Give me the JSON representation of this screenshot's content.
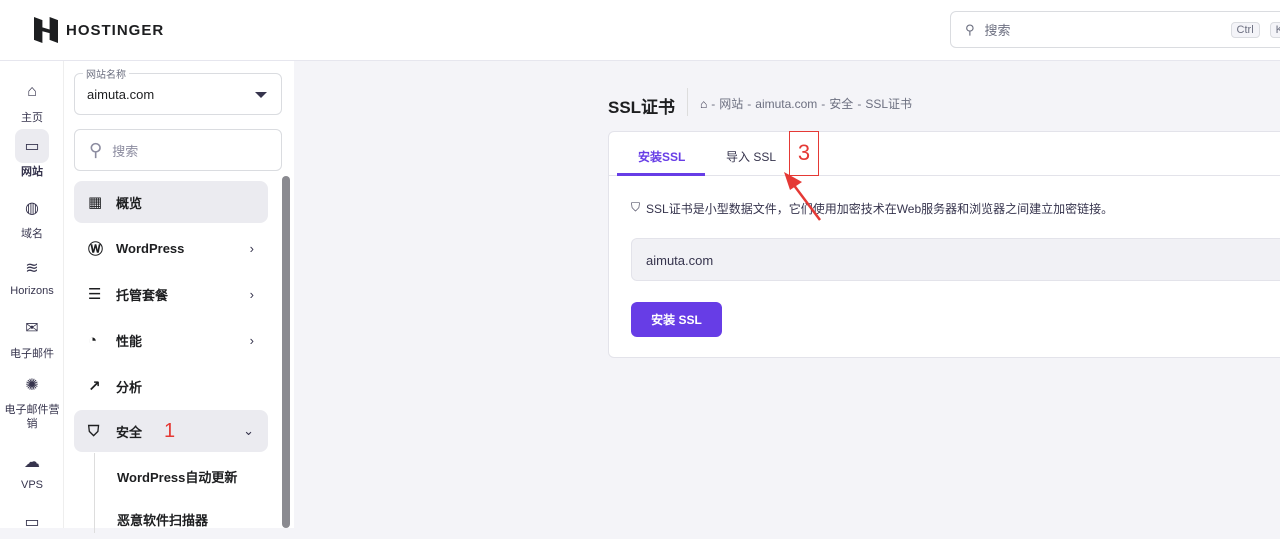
{
  "brand": "HOSTINGER",
  "search": {
    "placeholder": "搜索",
    "key1": "Ctrl",
    "key2": "K"
  },
  "rail": [
    {
      "label": "主页"
    },
    {
      "label": "网站"
    },
    {
      "label": "域名"
    },
    {
      "label": "Horizons"
    },
    {
      "label": "电子邮件"
    },
    {
      "label": "电子邮件营销"
    },
    {
      "label": "VPS"
    }
  ],
  "sidebar": {
    "site_label": "网站名称",
    "site_value": "aimuta.com",
    "search_placeholder": "搜索",
    "items": [
      {
        "label": "概览"
      },
      {
        "label": "WordPress"
      },
      {
        "label": "托管套餐"
      },
      {
        "label": "性能"
      },
      {
        "label": "分析"
      },
      {
        "label": "安全"
      }
    ],
    "sub_items": [
      {
        "label": "WordPress自动更新"
      },
      {
        "label": "恶意软件扫描器"
      }
    ],
    "annotation": "1"
  },
  "page": {
    "title": "SSL证书",
    "breadcrumb": [
      "网站",
      "aimuta.com",
      "安全",
      "SSL证书"
    ],
    "sep": "-"
  },
  "card": {
    "tabs": [
      {
        "label": "安装SSL"
      },
      {
        "label": "导入 SSL"
      }
    ],
    "annotation": "3",
    "info": "SSL证书是小型数据文件，它们使用加密技术在Web服务器和浏览器之间建立加密链接。",
    "domain_value": "aimuta.com",
    "install_button": "安装 SSL"
  },
  "colors": {
    "accent": "#673de6",
    "annotation": "#e53935"
  }
}
